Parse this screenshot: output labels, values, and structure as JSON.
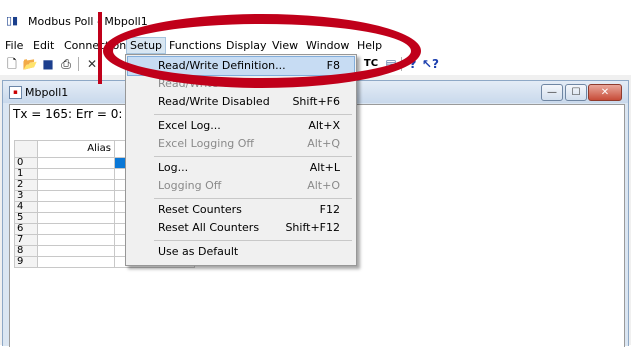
{
  "window": {
    "title": "Modbus Poll - Mbpoll1",
    "icon": "modbus-logo-icon"
  },
  "menubar": {
    "items": [
      "File",
      "Edit",
      "Connection",
      "Setup",
      "Functions",
      "Display",
      "View",
      "Window",
      "Help"
    ],
    "active": "Setup"
  },
  "toolbar": {
    "icons": [
      "new-icon",
      "open-icon",
      "save-icon",
      "print-icon",
      "cut-icon",
      "tc-icon",
      "help-icon",
      "context-help-icon"
    ],
    "tc_label": "TC"
  },
  "child_window": {
    "title": "Mbpoll1",
    "status": "Tx = 165: Err = 0: ID",
    "status_tail": "",
    "grid": {
      "header_alias": "Alias",
      "rows": [
        "0",
        "1",
        "2",
        "3",
        "4",
        "5",
        "6",
        "7",
        "8",
        "9"
      ]
    },
    "buttons": {
      "minimize": "—",
      "maximize": "☐",
      "close": "✕"
    }
  },
  "setup_menu": {
    "items": [
      {
        "label": "Read/Write Definition...",
        "shortcut": "F8",
        "state": "highlighted"
      },
      {
        "label": "Read/Write Once",
        "shortcut": "",
        "state": "disabled"
      },
      {
        "label": "Read/Write Disabled",
        "shortcut": "Shift+F6",
        "state": "normal"
      },
      {
        "label": "Excel Log...",
        "shortcut": "Alt+X",
        "state": "normal"
      },
      {
        "label": "Excel Logging Off",
        "shortcut": "Alt+Q",
        "state": "disabled"
      },
      {
        "label": "Log...",
        "shortcut": "Alt+L",
        "state": "normal"
      },
      {
        "label": "Logging Off",
        "shortcut": "Alt+O",
        "state": "disabled"
      },
      {
        "label": "Reset Counters",
        "shortcut": "F12",
        "state": "normal"
      },
      {
        "label": "Reset All Counters",
        "shortcut": "Shift+F12",
        "state": "normal"
      },
      {
        "label": "Use as Default",
        "shortcut": "",
        "state": "normal"
      }
    ]
  },
  "annotation": {
    "color": "#c0001a"
  }
}
